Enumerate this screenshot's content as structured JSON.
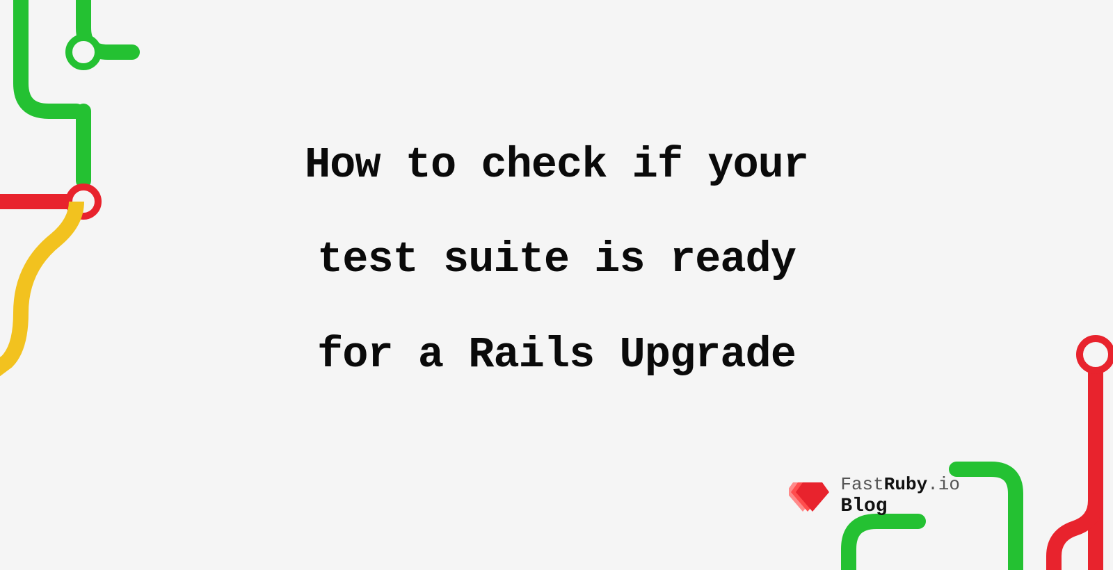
{
  "title_line1": "How to check if your",
  "title_line2": "test suite is ready",
  "title_line3": "for a Rails Upgrade",
  "logo": {
    "prefix": "Fast",
    "mid": "Ruby",
    "suffix": ".io",
    "subtitle": "Blog"
  },
  "colors": {
    "green": "#24c132",
    "red": "#e8232d",
    "yellow": "#f2c21f",
    "bg": "#f5f5f5"
  }
}
